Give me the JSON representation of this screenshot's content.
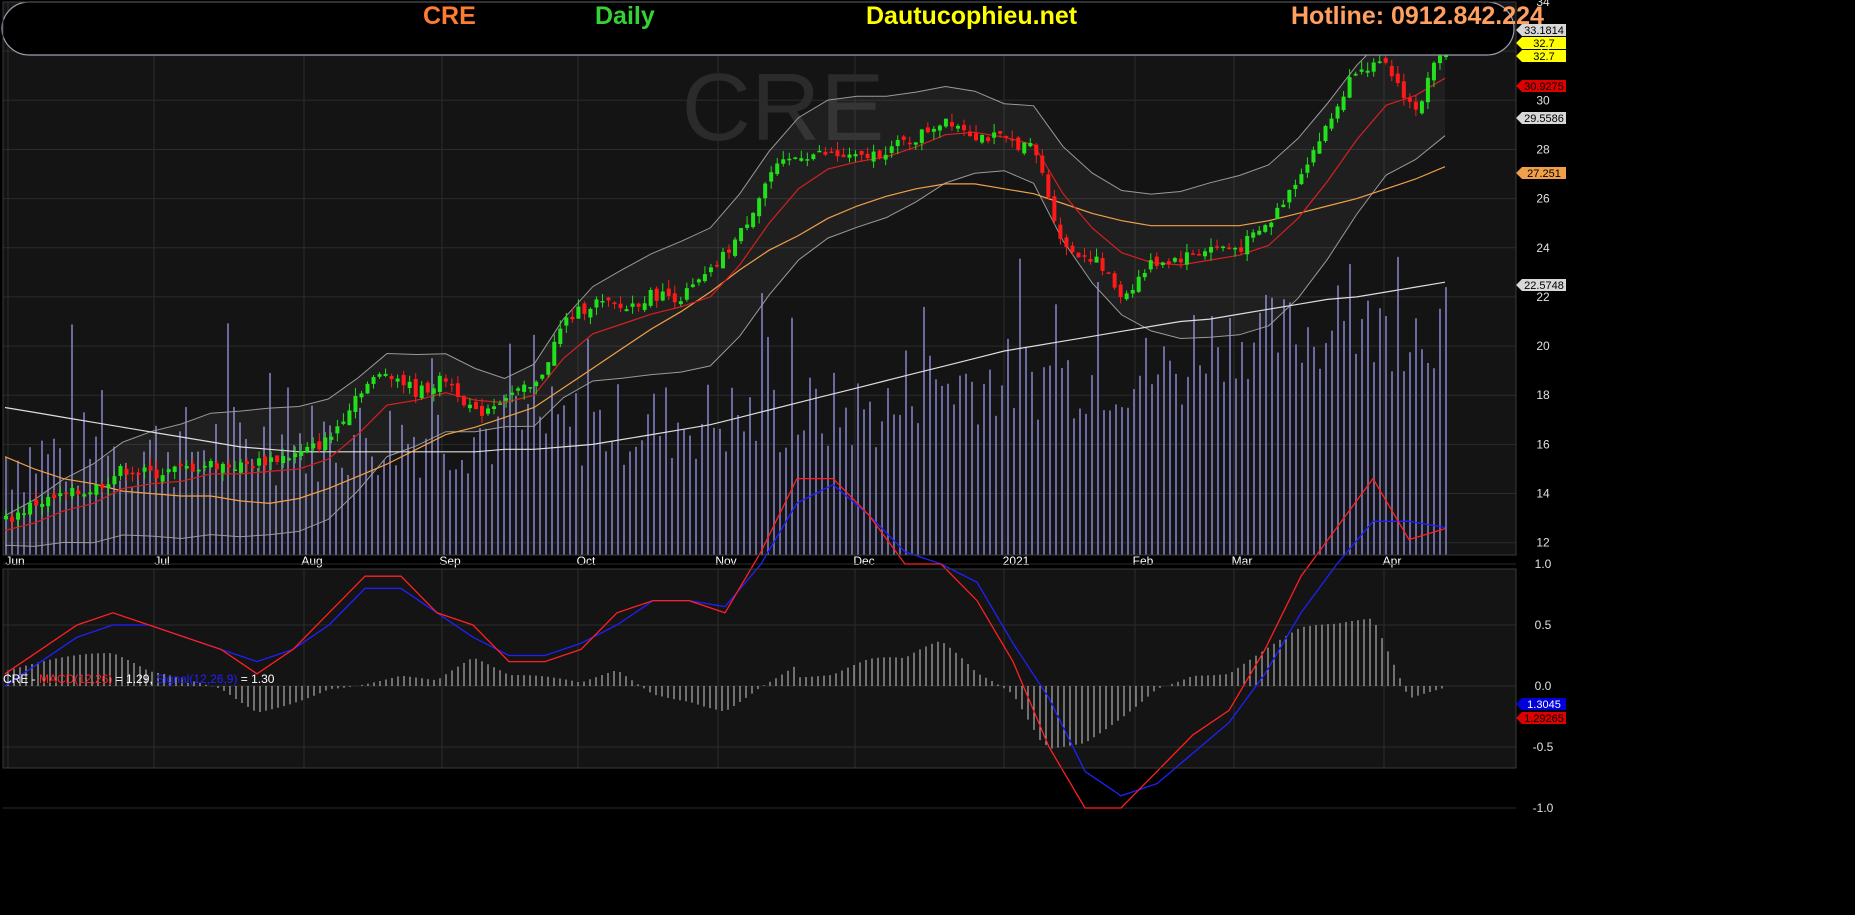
{
  "header": {
    "symbol": "CRE",
    "interval": "Daily",
    "site": "Dautucophieu.net",
    "hotline": "Hotline: 0912.842.224"
  },
  "colors": {
    "background": "#141414",
    "up_candle": "#22e01b",
    "down_candle": "#ff1a1a",
    "volume": "#6a6aa0",
    "ma20": "#d42020",
    "ma50": "#f0a04a",
    "ma200": "#dddddd",
    "bollinger": "#9a9a9a",
    "macd": "#ff2020",
    "signal": "#2020ff",
    "histogram": "#cccccc",
    "symbol": "#ff7a33",
    "interval": "#35d135",
    "site": "#ffff00",
    "hotline": "#ffa060"
  },
  "price_axis": {
    "ticks": [
      "34",
      "32",
      "30",
      "28",
      "26",
      "24",
      "22",
      "20",
      "18",
      "16",
      "14",
      "12"
    ],
    "tags": [
      {
        "text": "33.1814",
        "bg": "#d8d8d8",
        "fg": "#000000"
      },
      {
        "text": "32.7",
        "bg": "#ffff00",
        "fg": "#000000"
      },
      {
        "text": "32.7",
        "bg": "#ffff00",
        "fg": "#000000"
      },
      {
        "text": "30.9275",
        "bg": "#dd0000",
        "fg": "#000000"
      },
      {
        "text": "29.5586",
        "bg": "#d8d8d8",
        "fg": "#000000"
      },
      {
        "text": "27.251",
        "bg": "#f0a04a",
        "fg": "#000000"
      },
      {
        "text": "22.5748",
        "bg": "#d8d8d8",
        "fg": "#000000"
      }
    ]
  },
  "time_axis": {
    "labels": [
      "Jun",
      "Jul",
      "Aug",
      "Sep",
      "Oct",
      "Nov",
      "Dec",
      "2021",
      "Feb",
      "Mar",
      "Apr"
    ]
  },
  "macd_panel": {
    "legend_prefix": "CRE - ",
    "macd_label": "MACD(12,26)",
    "macd_value": " = 1.29, ",
    "signal_label": "Signal(12,26,9)",
    "signal_value": " = 1.30",
    "ticks": [
      "1.0",
      "0.5",
      "0.0",
      "-0.5",
      "-1.0"
    ],
    "tags": [
      {
        "text": "1.3045",
        "bg": "#0000dd",
        "fg": "#ffffff"
      },
      {
        "text": "1.29265",
        "bg": "#dd0000",
        "fg": "#000000"
      }
    ]
  },
  "chart_data": {
    "type": "candlestick",
    "symbol": "CRE",
    "interval": "Daily",
    "period": "Jun 2020 - Apr 2021",
    "ylim": [
      11.5,
      34
    ],
    "key_prices": {
      "high": 33.1814,
      "close": 32.7,
      "bollinger_mid": 30.9275,
      "bollinger_lower": 29.5586,
      "ma_medium": 27.251,
      "ma_long": 22.5748
    },
    "series": [
      {
        "name": "close",
        "values": [
          12.9,
          13.6,
          13.9,
          14.2,
          15.0,
          14.8,
          15.0,
          15.2,
          15.1,
          15.4,
          15.6,
          16.2,
          18.2,
          19.0,
          18.1,
          18.7,
          17.2,
          18.0,
          18.3,
          21.0,
          21.8,
          21.5,
          22.1,
          22.0,
          23.0,
          24.6,
          27.0,
          27.8,
          27.8,
          27.6,
          28.0,
          28.5,
          29.3,
          28.6,
          28.4,
          28.0,
          24.0,
          23.6,
          22.0,
          23.4,
          23.6,
          24.0,
          24.0,
          25.0,
          27.0,
          29.0,
          31.5,
          31.3,
          29.5,
          32.7
        ]
      },
      {
        "name": "ma20",
        "values": [
          12.5,
          12.8,
          13.3,
          13.6,
          14.2,
          14.4,
          14.5,
          14.8,
          14.8,
          14.9,
          15.0,
          15.4,
          16.4,
          17.6,
          17.8,
          18.1,
          17.8,
          17.7,
          18.0,
          19.5,
          20.5,
          20.9,
          21.3,
          21.6,
          22.0,
          23.3,
          25.0,
          26.4,
          27.2,
          27.5,
          27.7,
          28.1,
          28.6,
          28.7,
          28.5,
          28.2,
          26.2,
          24.8,
          23.8,
          23.4,
          23.3,
          23.5,
          23.7,
          24.1,
          25.2,
          26.7,
          28.4,
          29.8,
          30.2,
          30.9
        ]
      },
      {
        "name": "ma50",
        "values": [
          15.5,
          15.0,
          14.6,
          14.4,
          14.1,
          14.0,
          13.9,
          13.9,
          13.7,
          13.6,
          13.8,
          14.2,
          14.7,
          15.2,
          15.8,
          16.4,
          16.7,
          17.1,
          17.5,
          18.3,
          19.1,
          19.9,
          20.7,
          21.4,
          22.2,
          23.1,
          23.9,
          24.5,
          25.2,
          25.7,
          26.1,
          26.4,
          26.6,
          26.6,
          26.4,
          26.2,
          25.8,
          25.4,
          25.1,
          24.9,
          24.9,
          24.9,
          24.9,
          25.1,
          25.4,
          25.7,
          26.0,
          26.4,
          26.8,
          27.3
        ]
      },
      {
        "name": "ma200",
        "values": [
          17.5,
          17.3,
          17.1,
          16.9,
          16.7,
          16.5,
          16.3,
          16.1,
          15.9,
          15.8,
          15.7,
          15.7,
          15.7,
          15.7,
          15.7,
          15.7,
          15.7,
          15.8,
          15.8,
          15.9,
          16.0,
          16.2,
          16.4,
          16.6,
          16.8,
          17.1,
          17.4,
          17.7,
          18.0,
          18.3,
          18.6,
          18.9,
          19.2,
          19.5,
          19.8,
          20.0,
          20.2,
          20.4,
          20.6,
          20.8,
          21.0,
          21.1,
          21.3,
          21.5,
          21.7,
          21.9,
          22.0,
          22.2,
          22.4,
          22.6
        ]
      },
      {
        "name": "macd",
        "values": [
          0.1,
          0.3,
          0.5,
          0.6,
          0.5,
          0.4,
          0.3,
          0.1,
          0.3,
          0.6,
          0.9,
          0.9,
          0.6,
          0.5,
          0.2,
          0.2,
          0.3,
          0.6,
          0.7,
          0.7,
          0.6,
          1.1,
          1.7,
          1.7,
          1.4,
          1.0,
          1.0,
          0.7,
          0.2,
          -0.5,
          -1.0,
          -1.0,
          -0.7,
          -0.4,
          -0.2,
          0.3,
          0.9,
          1.3,
          1.7,
          1.2,
          1.29
        ]
      },
      {
        "name": "signal",
        "values": [
          0.0,
          0.2,
          0.4,
          0.5,
          0.5,
          0.4,
          0.3,
          0.2,
          0.3,
          0.5,
          0.8,
          0.8,
          0.6,
          0.4,
          0.25,
          0.25,
          0.35,
          0.5,
          0.7,
          0.7,
          0.65,
          1.0,
          1.5,
          1.65,
          1.4,
          1.1,
          1.0,
          0.85,
          0.35,
          -0.1,
          -0.7,
          -0.9,
          -0.8,
          -0.55,
          -0.3,
          0.1,
          0.6,
          1.0,
          1.35,
          1.35,
          1.3
        ]
      }
    ]
  }
}
